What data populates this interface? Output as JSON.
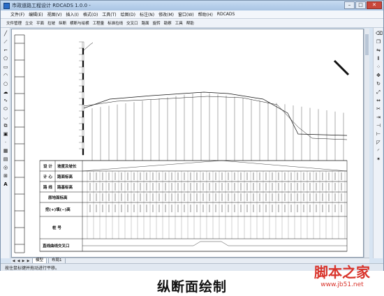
{
  "window": {
    "title": "市政道路工程设计 RDCADS 1.0.0 -",
    "controls": [
      "–",
      "□",
      "✕"
    ]
  },
  "menubar": {
    "items": [
      "文件(F)",
      "编辑(E)",
      "视图(V)",
      "插入(I)",
      "格式(O)",
      "工具(T)",
      "绘图(D)",
      "标注(N)",
      "修改(M)",
      "窗口(W)",
      "帮助(H)",
      "RDCADS"
    ]
  },
  "toolbar": {
    "items": [
      "文件管理",
      "立交",
      "平面",
      "拉坡",
      "纵断",
      "横断与绘横",
      "工程量",
      "标准拉线",
      "交叉口",
      "路面",
      "旋转",
      "勘察",
      "工具",
      "帮助"
    ]
  },
  "profile": {
    "table_labels": {
      "row1_a": "设 计",
      "row1_b": "坡度及坡长",
      "row2_a": "计 心",
      "row2_b": "路面标高",
      "row3_a": "路 线",
      "row3_b": "路基标高",
      "row4": "原地面标高",
      "row5": "挖(+)填(−)高",
      "row6": "桩    号",
      "row7": "直线曲线交叉口"
    }
  },
  "tabs": {
    "nav": [
      "◀",
      "◀",
      "▶",
      "▶"
    ],
    "items": [
      {
        "label": "模型",
        "active": true
      },
      {
        "label": "布局1",
        "active": false
      }
    ]
  },
  "statusbar": {
    "text": "按住鼠标键并拖动进行平移。"
  },
  "caption": "纵断面绘制",
  "watermark": {
    "logo": "脚本之家",
    "url": "www.jb51.net",
    "color": "#d9342b"
  }
}
